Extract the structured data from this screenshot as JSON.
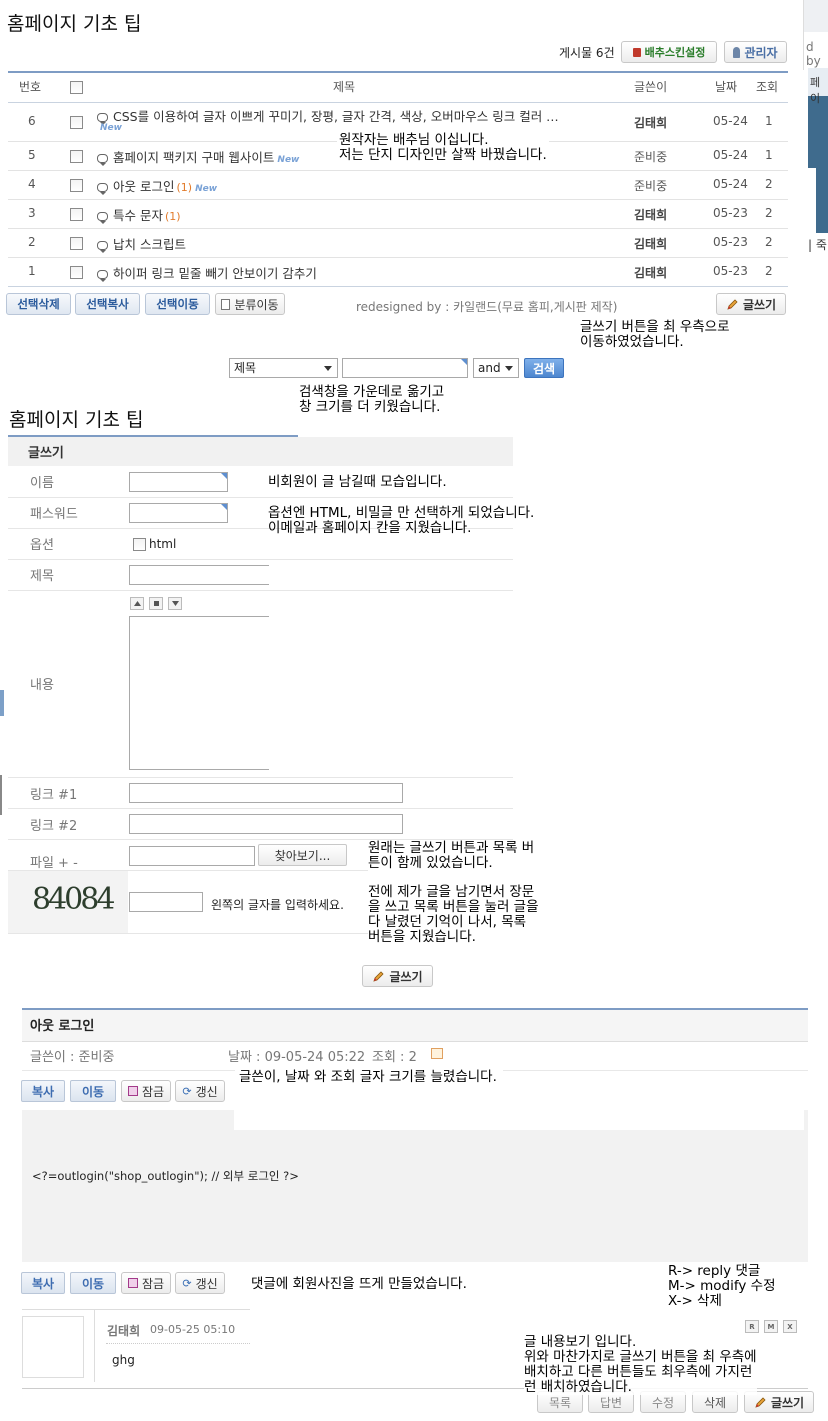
{
  "board": {
    "title": "홈페이지 기초 팁",
    "post_count": "게시물 6건",
    "btn_skin": "배추스킨설정",
    "btn_admin": "관리자",
    "headers": {
      "num": "번호",
      "subject": "제목",
      "author": "글쓴이",
      "date": "날짜",
      "views": "조회"
    },
    "rows": [
      {
        "num": "6",
        "subject": "CSS를 이용하여 글자 이쁘게 꾸미기, 장평, 글자 간격, 색상, 오버마우스 링크 컬러 …",
        "comments": "",
        "new": "New",
        "author": "김태희",
        "date": "05-24",
        "views": "1"
      },
      {
        "num": "5",
        "subject": "홈페이지 팩키지 구매 웹사이트",
        "comments": "",
        "new": "New",
        "author": "준비중",
        "date": "05-24",
        "views": "1"
      },
      {
        "num": "4",
        "subject": "아웃 로그인",
        "comments": "(1)",
        "new": "New",
        "author": "준비중",
        "date": "05-24",
        "views": "2"
      },
      {
        "num": "3",
        "subject": "특수 문자",
        "comments": "(1)",
        "new": "",
        "author": "김태희",
        "date": "05-23",
        "views": "2"
      },
      {
        "num": "2",
        "subject": "납치 스크립트",
        "comments": "",
        "new": "",
        "author": "김태희",
        "date": "05-23",
        "views": "2"
      },
      {
        "num": "1",
        "subject": "하이퍼 링크 밑줄 빼기 안보이기 감추기",
        "comments": "",
        "new": "",
        "author": "김태희",
        "date": "05-23",
        "views": "2"
      }
    ],
    "btn_delete": "선택삭제",
    "btn_copy": "선택복사",
    "btn_move": "선택이동",
    "btn_category": "분류이동",
    "redesigned": "redesigned by : 카일랜드(무료 홈피,게시판 제작)",
    "btn_write": "글쓰기",
    "search": {
      "field": "제목",
      "op": "and",
      "btn": "검색"
    }
  },
  "notes": {
    "n1": "원작자는 배추님 이십니다.\n저는 단지 디자인만 살짝 바꿨습니다.",
    "n2": "글쓰기 버튼을 최 우측으로\n이동하였었습니다.",
    "n3": "검색창을 가운데로 옮기고\n창 크기를 더 키웠습니다.",
    "n4": "비회원이 글 남길때 모습입니다.",
    "n5": "옵션엔 HTML, 비밀글 만 선택하게 되었습니다.\n이메일과 홈페이지 칸을 지웠습니다.",
    "n6": "원래는 글쓰기 버튼과 목록 버\n튼이 함께 있었습니다.",
    "n7": "전에 제가 글을 남기면서 장문\n을 쓰고 목록 버튼을 눌러 글을\n다 날렸던 기억이 나서, 목록\n버튼을 지웠습니다.",
    "n8": "글쓴이, 날짜 와 조회 글자 크기를 늘렸습니다.",
    "n9": "댓글에 회원사진을 뜨게 만들었습니다.",
    "n10": "R-> reply 댓글\nM-> modify 수정\nX-> 삭제",
    "n11": "글 내용보기 입니다.\n위와 마찬가지로 글쓰기 버튼을 최 우측에\n 배치하고 다른 버튼들도 최우측에 가지런\n런 배치하였습니다."
  },
  "write": {
    "title": "홈페이지 기초 팁",
    "header": "글쓰기",
    "labels": {
      "name": "이름",
      "password": "패스워드",
      "option": "옵션",
      "subject": "제목",
      "content": "내용",
      "link1": "링크 #1",
      "link2": "링크 #2",
      "file": "파일 + -"
    },
    "html_label": "html",
    "browse": "찾아보기...",
    "captcha": "84084",
    "captcha_hint": "왼쪽의 글자를 입력하세요.",
    "btn_write": "글쓰기"
  },
  "view": {
    "title": "아웃 로그인",
    "author": "글쓴이 : 준비중",
    "date": "날짜 : 09-05-24 05:22",
    "views": "조회 : 2",
    "btn_copy": "복사",
    "btn_move": "이동",
    "btn_lock": "잠금",
    "btn_refresh": "갱신",
    "content": "<?=outlogin(\"shop_outlogin\"); // 외부 로그인 ?>",
    "comment_author": "김태희",
    "comment_date": "09-05-25 05:10",
    "comment_text": "ghg",
    "btn_list": "목록",
    "btn_reply": "답변",
    "btn_modify": "수정",
    "btn_del": "삭제",
    "btn_write": "글쓰기",
    "small_r": "R",
    "small_m": "M",
    "small_x": "X"
  },
  "edge": {
    "text1": "d by",
    "text2": "페이",
    "text3": "| 죽"
  }
}
